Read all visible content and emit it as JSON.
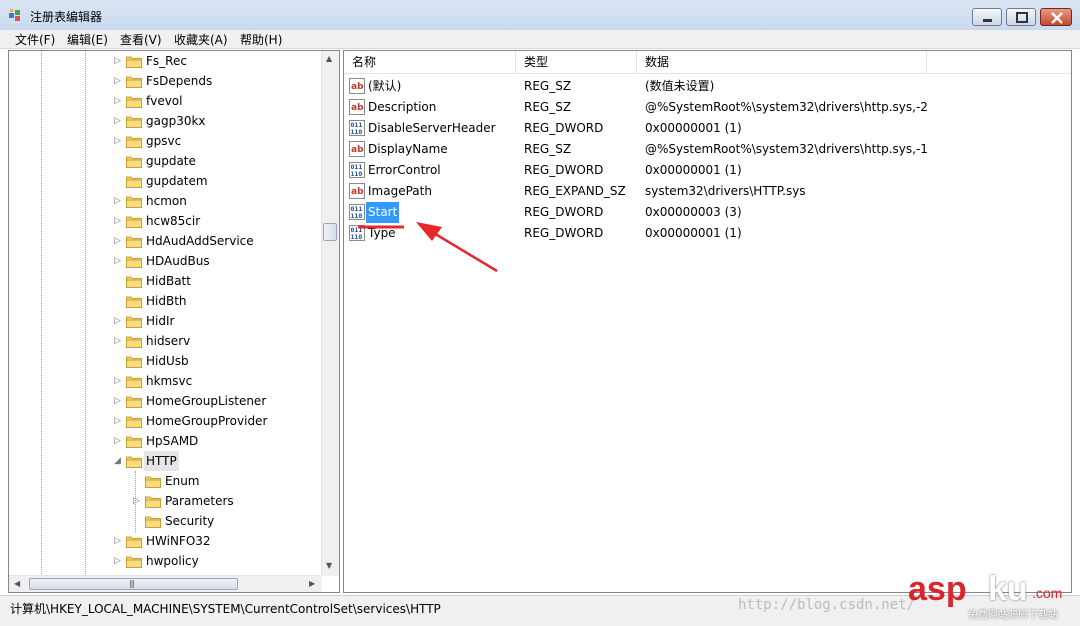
{
  "window": {
    "title": "注册表编辑器"
  },
  "menu": [
    "文件(F)",
    "编辑(E)",
    "查看(V)",
    "收藏夹(A)",
    "帮助(H)"
  ],
  "tree": {
    "nodes": [
      {
        "label": "Fs_Rec",
        "expandable": true
      },
      {
        "label": "FsDepends",
        "expandable": true
      },
      {
        "label": "fvevol",
        "expandable": true
      },
      {
        "label": "gagp30kx",
        "expandable": true
      },
      {
        "label": "gpsvc",
        "expandable": true
      },
      {
        "label": "gupdate",
        "expandable": false
      },
      {
        "label": "gupdatem",
        "expandable": false
      },
      {
        "label": "hcmon",
        "expandable": true
      },
      {
        "label": "hcw85cir",
        "expandable": true
      },
      {
        "label": "HdAudAddService",
        "expandable": true
      },
      {
        "label": "HDAudBus",
        "expandable": true
      },
      {
        "label": "HidBatt",
        "expandable": false
      },
      {
        "label": "HidBth",
        "expandable": false
      },
      {
        "label": "HidIr",
        "expandable": true
      },
      {
        "label": "hidserv",
        "expandable": true
      },
      {
        "label": "HidUsb",
        "expandable": false
      },
      {
        "label": "hkmsvc",
        "expandable": true
      },
      {
        "label": "HomeGroupListener",
        "expandable": true
      },
      {
        "label": "HomeGroupProvider",
        "expandable": true
      },
      {
        "label": "HpSAMD",
        "expandable": true
      },
      {
        "label": "HTTP",
        "expandable": true,
        "expanded": true,
        "selected": true
      },
      {
        "label": "Enum",
        "expandable": false,
        "child": true
      },
      {
        "label": "Parameters",
        "expandable": true,
        "child": true
      },
      {
        "label": "Security",
        "expandable": false,
        "child": true
      },
      {
        "label": "HWiNFO32",
        "expandable": true
      },
      {
        "label": "hwpolicy",
        "expandable": true
      }
    ]
  },
  "list": {
    "columns": [
      "名称",
      "类型",
      "数据"
    ],
    "rows": [
      {
        "icon": "string-value-icon",
        "name": "(默认)",
        "type": "REG_SZ",
        "data": "(数值未设置)"
      },
      {
        "icon": "string-value-icon",
        "name": "Description",
        "type": "REG_SZ",
        "data": "@%SystemRoot%\\system32\\drivers\\http.sys,-2"
      },
      {
        "icon": "binary-value-icon",
        "name": "DisableServerHeader",
        "type": "REG_DWORD",
        "data": "0x00000001 (1)"
      },
      {
        "icon": "string-value-icon",
        "name": "DisplayName",
        "type": "REG_SZ",
        "data": "@%SystemRoot%\\system32\\drivers\\http.sys,-1"
      },
      {
        "icon": "binary-value-icon",
        "name": "ErrorControl",
        "type": "REG_DWORD",
        "data": "0x00000001 (1)"
      },
      {
        "icon": "string-value-icon",
        "name": "ImagePath",
        "type": "REG_EXPAND_SZ",
        "data": "system32\\drivers\\HTTP.sys"
      },
      {
        "icon": "binary-value-icon",
        "name": "Start",
        "type": "REG_DWORD",
        "data": "0x00000003 (3)",
        "selected": true
      },
      {
        "icon": "binary-value-icon",
        "name": "Type",
        "type": "REG_DWORD",
        "data": "0x00000001 (1)"
      }
    ]
  },
  "status": {
    "path": "计算机\\HKEY_LOCAL_MACHINE\\SYSTEM\\CurrentControlSet\\services\\HTTP"
  },
  "overlay": {
    "watermark": "http://blog.csdn.net/",
    "logo_asp": "asp",
    "logo_ku": "ku",
    "logo_com": ".com",
    "logo_sub": "免费网站源码下载站",
    "annotation_color": "#e8262b"
  }
}
